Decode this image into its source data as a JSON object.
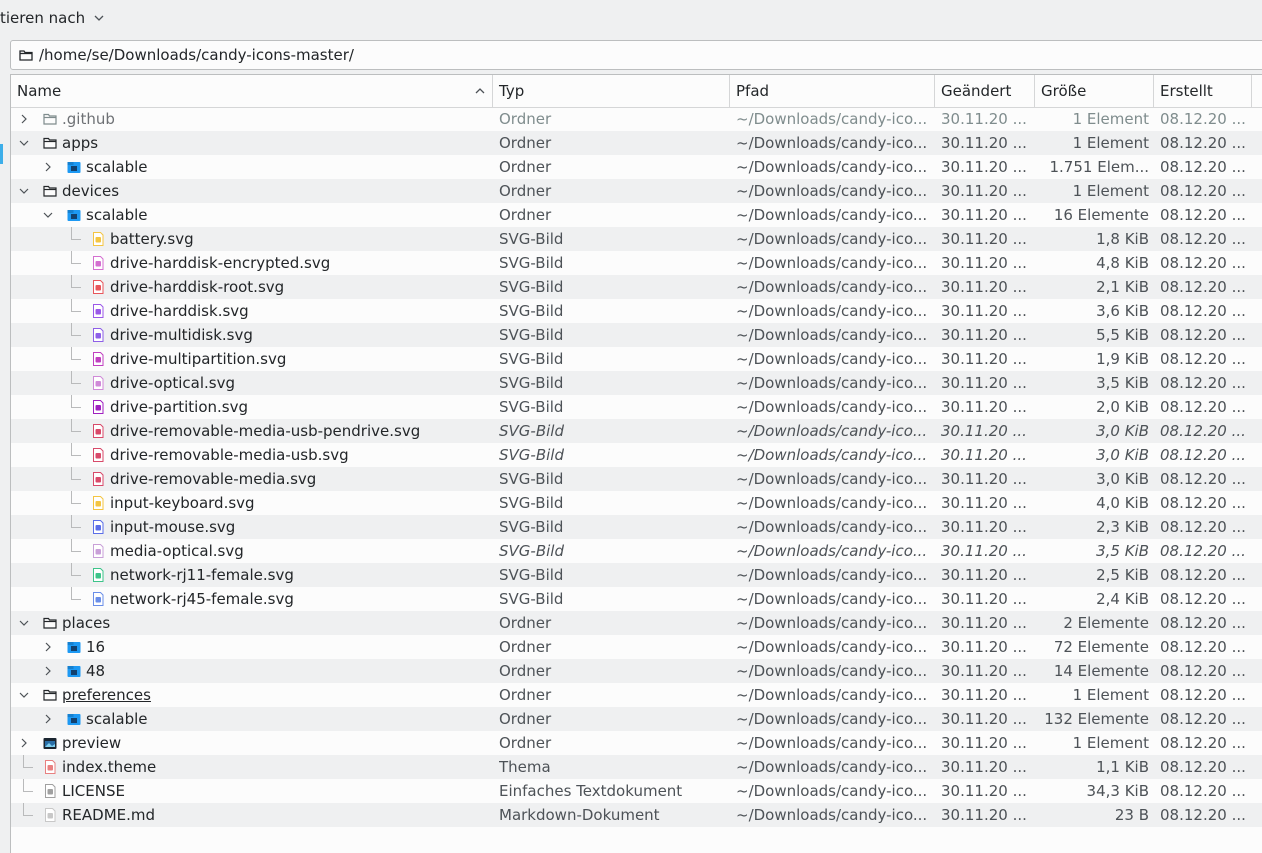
{
  "toolbar": {
    "sort_label": "tieren nach"
  },
  "location": {
    "path": "/home/se/Downloads/candy-icons-master/"
  },
  "columns": {
    "name": "Name",
    "type": "Typ",
    "path": "Pfad",
    "modified": "Geändert",
    "size": "Größe",
    "created": "Erstellt"
  },
  "rows": [
    {
      "name": ".github",
      "type": "Ordner",
      "path": "~/Downloads/candy-ico...",
      "modified": "30.11.20 ...",
      "size": "1 Element",
      "created": "08.12.20 ...",
      "depth": 0,
      "expander": "right",
      "icon": "folder-dark-icon",
      "dim": true
    },
    {
      "name": "apps",
      "type": "Ordner",
      "path": "~/Downloads/candy-ico...",
      "modified": "30.11.20 ...",
      "size": "1 Element",
      "created": "08.12.20 ...",
      "depth": 0,
      "expander": "down",
      "icon": "folder-dark-icon"
    },
    {
      "name": "scalable",
      "type": "Ordner",
      "path": "~/Downloads/candy-ico...",
      "modified": "30.11.20 ...",
      "size": "1.751 Elem...",
      "created": "08.12.20 ...",
      "depth": 1,
      "expander": "right",
      "icon": "folder-blue-icon"
    },
    {
      "name": "devices",
      "type": "Ordner",
      "path": "~/Downloads/candy-ico...",
      "modified": "30.11.20 ...",
      "size": "1 Element",
      "created": "08.12.20 ...",
      "depth": 0,
      "expander": "down",
      "icon": "folder-dark-icon"
    },
    {
      "name": "scalable",
      "type": "Ordner",
      "path": "~/Downloads/candy-ico...",
      "modified": "30.11.20 ...",
      "size": "16 Elemente",
      "created": "08.12.20 ...",
      "depth": 1,
      "expander": "down",
      "icon": "folder-blue-icon"
    },
    {
      "name": "battery.svg",
      "type": "SVG-Bild",
      "path": "~/Downloads/candy-ico...",
      "modified": "30.11.20 ...",
      "size": "1,8 KiB",
      "created": "08.12.20 ...",
      "depth": 2,
      "expander": "none",
      "icon": "battery-icon",
      "color": "#f4c542"
    },
    {
      "name": "drive-harddisk-encrypted.svg",
      "type": "SVG-Bild",
      "path": "~/Downloads/candy-ico...",
      "modified": "30.11.20 ...",
      "size": "4,8 KiB",
      "created": "08.12.20 ...",
      "depth": 2,
      "expander": "none",
      "icon": "harddisk-encrypted-icon",
      "color": "#d46fd0"
    },
    {
      "name": "drive-harddisk-root.svg",
      "type": "SVG-Bild",
      "path": "~/Downloads/candy-ico...",
      "modified": "30.11.20 ...",
      "size": "2,1 KiB",
      "created": "08.12.20 ...",
      "depth": 2,
      "expander": "none",
      "icon": "harddisk-root-icon",
      "color": "#e8565b"
    },
    {
      "name": "drive-harddisk.svg",
      "type": "SVG-Bild",
      "path": "~/Downloads/candy-ico...",
      "modified": "30.11.20 ...",
      "size": "3,6 KiB",
      "created": "08.12.20 ...",
      "depth": 2,
      "expander": "none",
      "icon": "harddisk-icon",
      "color": "#9b59e8"
    },
    {
      "name": "drive-multidisk.svg",
      "type": "SVG-Bild",
      "path": "~/Downloads/candy-ico...",
      "modified": "30.11.20 ...",
      "size": "5,5 KiB",
      "created": "08.12.20 ...",
      "depth": 2,
      "expander": "none",
      "icon": "multidisk-icon",
      "color": "#8e5fe8"
    },
    {
      "name": "drive-multipartition.svg",
      "type": "SVG-Bild",
      "path": "~/Downloads/candy-ico...",
      "modified": "30.11.20 ...",
      "size": "1,9 KiB",
      "created": "08.12.20 ...",
      "depth": 2,
      "expander": "none",
      "icon": "multipartition-icon",
      "color": "#c040c0"
    },
    {
      "name": "drive-optical.svg",
      "type": "SVG-Bild",
      "path": "~/Downloads/candy-ico...",
      "modified": "30.11.20 ...",
      "size": "3,5 KiB",
      "created": "08.12.20 ...",
      "depth": 2,
      "expander": "none",
      "icon": "optical-drive-icon",
      "color": "#d08ad8"
    },
    {
      "name": "drive-partition.svg",
      "type": "SVG-Bild",
      "path": "~/Downloads/candy-ico...",
      "modified": "30.11.20 ...",
      "size": "2,0 KiB",
      "created": "08.12.20 ...",
      "depth": 2,
      "expander": "none",
      "icon": "partition-icon",
      "color": "#a020c0"
    },
    {
      "name": "drive-removable-media-usb-pendrive.svg",
      "type": "SVG-Bild",
      "path": "~/Downloads/candy-ico...",
      "modified": "30.11.20 ...",
      "size": "3,0 KiB",
      "created": "08.12.20 ...",
      "depth": 2,
      "expander": "none",
      "icon": "usb-pendrive-icon",
      "color": "#d84a6a",
      "italic": true
    },
    {
      "name": "drive-removable-media-usb.svg",
      "type": "SVG-Bild",
      "path": "~/Downloads/candy-ico...",
      "modified": "30.11.20 ...",
      "size": "3,0 KiB",
      "created": "08.12.20 ...",
      "depth": 2,
      "expander": "none",
      "icon": "usb-media-icon",
      "color": "#d84a6a",
      "italic": true
    },
    {
      "name": "drive-removable-media.svg",
      "type": "SVG-Bild",
      "path": "~/Downloads/candy-ico...",
      "modified": "30.11.20 ...",
      "size": "3,0 KiB",
      "created": "08.12.20 ...",
      "depth": 2,
      "expander": "none",
      "icon": "removable-media-icon",
      "color": "#d84a6a"
    },
    {
      "name": "input-keyboard.svg",
      "type": "SVG-Bild",
      "path": "~/Downloads/candy-ico...",
      "modified": "30.11.20 ...",
      "size": "4,0 KiB",
      "created": "08.12.20 ...",
      "depth": 2,
      "expander": "none",
      "icon": "keyboard-icon",
      "color": "#f4c542"
    },
    {
      "name": "input-mouse.svg",
      "type": "SVG-Bild",
      "path": "~/Downloads/candy-ico...",
      "modified": "30.11.20 ...",
      "size": "2,3 KiB",
      "created": "08.12.20 ...",
      "depth": 2,
      "expander": "none",
      "icon": "mouse-icon",
      "color": "#5b6ee8"
    },
    {
      "name": "media-optical.svg",
      "type": "SVG-Bild",
      "path": "~/Downloads/candy-ico...",
      "modified": "30.11.20 ...",
      "size": "3,5 KiB",
      "created": "08.12.20 ...",
      "depth": 2,
      "expander": "none",
      "icon": "media-optical-icon",
      "color": "#c9a0d8",
      "italic": true
    },
    {
      "name": "network-rj11-female.svg",
      "type": "SVG-Bild",
      "path": "~/Downloads/candy-ico...",
      "modified": "30.11.20 ...",
      "size": "2,5 KiB",
      "created": "08.12.20 ...",
      "depth": 2,
      "expander": "none",
      "icon": "rj11-icon",
      "color": "#3dc48a"
    },
    {
      "name": "network-rj45-female.svg",
      "type": "SVG-Bild",
      "path": "~/Downloads/candy-ico...",
      "modified": "30.11.20 ...",
      "size": "2,4 KiB",
      "created": "08.12.20 ...",
      "depth": 2,
      "expander": "none",
      "icon": "rj45-icon",
      "color": "#6a8ee8"
    },
    {
      "name": "places",
      "type": "Ordner",
      "path": "~/Downloads/candy-ico...",
      "modified": "30.11.20 ...",
      "size": "2 Elemente",
      "created": "08.12.20 ...",
      "depth": 0,
      "expander": "down",
      "icon": "folder-dark-icon"
    },
    {
      "name": "16",
      "type": "Ordner",
      "path": "~/Downloads/candy-ico...",
      "modified": "30.11.20 ...",
      "size": "72 Elemente",
      "created": "08.12.20 ...",
      "depth": 1,
      "expander": "right",
      "icon": "folder-blue-icon"
    },
    {
      "name": "48",
      "type": "Ordner",
      "path": "~/Downloads/candy-ico...",
      "modified": "30.11.20 ...",
      "size": "14 Elemente",
      "created": "08.12.20 ...",
      "depth": 1,
      "expander": "right",
      "icon": "folder-blue-icon"
    },
    {
      "name": "preferences",
      "type": "Ordner",
      "path": "~/Downloads/candy-ico...",
      "modified": "30.11.20 ...",
      "size": "1 Element",
      "created": "08.12.20 ...",
      "depth": 0,
      "expander": "down",
      "icon": "folder-dark-icon",
      "underline": true
    },
    {
      "name": "scalable",
      "type": "Ordner",
      "path": "~/Downloads/candy-ico...",
      "modified": "30.11.20 ...",
      "size": "132 Elemente",
      "created": "08.12.20 ...",
      "depth": 1,
      "expander": "right",
      "icon": "folder-blue-icon"
    },
    {
      "name": "preview",
      "type": "Ordner",
      "path": "~/Downloads/candy-ico...",
      "modified": "30.11.20 ...",
      "size": "1 Element",
      "created": "08.12.20 ...",
      "depth": 0,
      "expander": "right",
      "icon": "folder-image-icon"
    },
    {
      "name": "index.theme",
      "type": "Thema",
      "path": "~/Downloads/candy-ico...",
      "modified": "30.11.20 ...",
      "size": "1,1 KiB",
      "created": "08.12.20 ...",
      "depth": 0,
      "expander": "none",
      "icon": "theme-file-icon",
      "color": "#e88080"
    },
    {
      "name": "LICENSE",
      "type": "Einfaches Textdokument",
      "path": "~/Downloads/candy-ico...",
      "modified": "30.11.20 ...",
      "size": "34,3 KiB",
      "created": "08.12.20 ...",
      "depth": 0,
      "expander": "none",
      "icon": "text-file-icon",
      "color": "#a0a0a0"
    },
    {
      "name": "README.md",
      "type": "Markdown-Dokument",
      "path": "~/Downloads/candy-ico...",
      "modified": "30.11.20 ...",
      "size": "23 B",
      "created": "08.12.20 ...",
      "depth": 0,
      "expander": "none",
      "icon": "markdown-file-icon",
      "color": "#c8c8c8"
    }
  ]
}
